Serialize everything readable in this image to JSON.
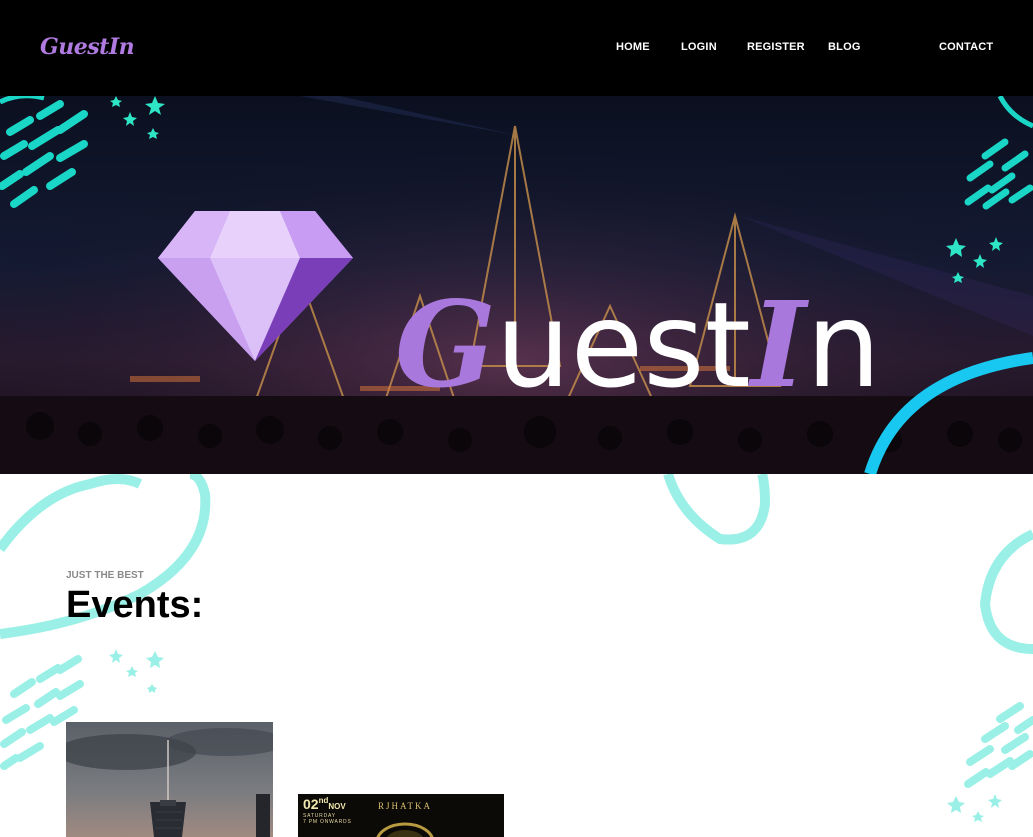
{
  "header": {
    "brand": "GuestIn",
    "nav": [
      {
        "label": "HOME"
      },
      {
        "label": "LOGIN"
      },
      {
        "label": "REGISTER"
      },
      {
        "label": "BLOG"
      },
      {
        "label": "CONTACT"
      }
    ]
  },
  "hero": {
    "wordmark_guest_g": "G",
    "wordmark_guest_rest": "uest",
    "wordmark_in_i": "I",
    "wordmark_in_rest": "n"
  },
  "events": {
    "kicker": "JUST THE BEST",
    "title": "Events:",
    "cards": [
      {
        "kind": "city-skyline"
      },
      {
        "kind": "poster",
        "date_day": "02",
        "date_sup": "nd",
        "date_month": "NOV",
        "line1": "SATURDAY",
        "line2": "7 PM ONWARDS",
        "brand": "RJHATKA"
      }
    ]
  },
  "colors": {
    "brand_purple": "#b07be0",
    "accent_teal": "#2ee6c6",
    "accent_cyan": "#18c8f0",
    "decor_mint": "#9af0e6"
  }
}
